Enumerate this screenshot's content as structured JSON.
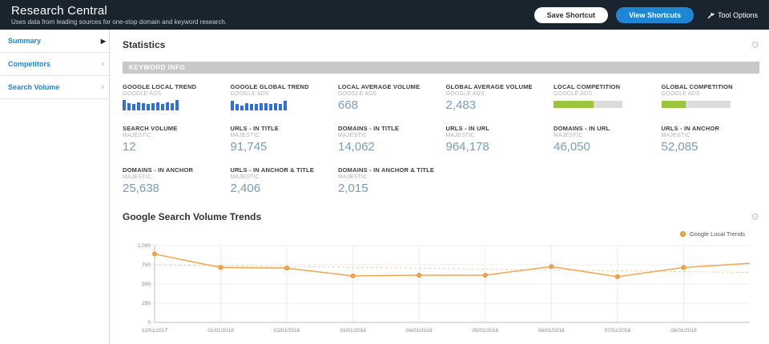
{
  "icons": {
    "gear": "⚙",
    "active_arrow": "▶",
    "chevron": "›"
  },
  "colors": {
    "accent_blue": "#1e87d5",
    "bar_blue": "#2f6fd8",
    "competition_green": "#9bc53d",
    "line_orange": "#f5a54b",
    "header_bg": "#1a242e"
  },
  "header": {
    "title": "Research Central",
    "subtitle": "Uses data from leading sources for one-stop domain and keyword research.",
    "save_button": "Save Shortcut",
    "view_button": "View Shortcuts",
    "tool_options": "Tool Options"
  },
  "sidebar": {
    "items": [
      {
        "label": "Summary",
        "active": true
      },
      {
        "label": "Competitors",
        "active": false
      },
      {
        "label": "Search Volume",
        "active": false
      }
    ]
  },
  "statistics": {
    "title": "Statistics",
    "band": "KEYWORD INFO",
    "stats": [
      {
        "label": "GOOGLE LOCAL TREND",
        "source": "GOOGLE ADS",
        "type": "bars",
        "bars": [
          10,
          7,
          6,
          8,
          7,
          6,
          7,
          8,
          6,
          8,
          7,
          10
        ]
      },
      {
        "label": "GOOGLE GLOBAL TREND",
        "source": "GOOGLE ADS",
        "type": "bars",
        "bars": [
          9,
          6,
          5,
          7,
          6,
          6,
          7,
          7,
          6,
          7,
          6,
          9
        ]
      },
      {
        "label": "LOCAL AVERAGE VOLUME",
        "source": "GOOGLE ADS",
        "type": "value",
        "value": "668"
      },
      {
        "label": "GLOBAL AVERAGE VOLUME",
        "source": "GOOGLE ADS",
        "type": "value",
        "value": "2,483"
      },
      {
        "label": "LOCAL COMPETITION",
        "source": "GOOGLE ADS",
        "type": "progress",
        "percent": 58
      },
      {
        "label": "GLOBAL COMPETITION",
        "source": "GOOGLE ADS",
        "type": "progress",
        "percent": 36
      },
      {
        "label": "SEARCH VOLUME",
        "source": "MAJESTIC",
        "type": "value",
        "value": "12"
      },
      {
        "label": "URLS - IN TITLE",
        "source": "MAJESTIC",
        "type": "value",
        "value": "91,745"
      },
      {
        "label": "DOMAINS - IN TITLE",
        "source": "MAJESTIC",
        "type": "value",
        "value": "14,062"
      },
      {
        "label": "URLS - IN URL",
        "source": "MAJESTIC",
        "type": "value",
        "value": "964,178"
      },
      {
        "label": "DOMAINS - IN URL",
        "source": "MAJESTIC",
        "type": "value",
        "value": "46,050"
      },
      {
        "label": "URLS - IN ANCHOR",
        "source": "MAJESTIC",
        "type": "value",
        "value": "52,085"
      },
      {
        "label": "DOMAINS - IN ANCHOR",
        "source": "MAJESTIC",
        "type": "value",
        "value": "25,638"
      },
      {
        "label": "URLS - IN ANCHOR & TITLE",
        "source": "MAJESTIC",
        "type": "value",
        "value": "2,406"
      },
      {
        "label": "DOMAINS - IN ANCHOR & TITLE",
        "source": "MAJESTIC",
        "type": "value",
        "value": "2,015"
      }
    ]
  },
  "chart_section": {
    "title": "Google Search Volume Trends"
  },
  "chart_data": {
    "type": "line",
    "title": "Google Search Volume Trends",
    "x": [
      "12/01/2017",
      "01/01/2018",
      "02/01/2018",
      "03/01/2018",
      "04/01/2018",
      "05/01/2018",
      "06/01/2018",
      "07/01/2018",
      "08/01/2018"
    ],
    "series": [
      {
        "name": "Google Local Trends",
        "values": [
          890,
          715,
          707,
          605,
          615,
          615,
          727,
          595,
          715,
          770
        ]
      }
    ],
    "ylim": [
      0,
      1000
    ],
    "yticks": [
      {
        "v": 0,
        "label": "0"
      },
      {
        "v": 250,
        "label": "250"
      },
      {
        "v": 500,
        "label": "500"
      },
      {
        "v": 750,
        "label": "750"
      },
      {
        "v": 1000,
        "label": "1,000"
      }
    ],
    "trend": {
      "start": 750,
      "end": 650
    },
    "grid": true,
    "legend_position": "top-right",
    "color": "#f5a54b"
  }
}
